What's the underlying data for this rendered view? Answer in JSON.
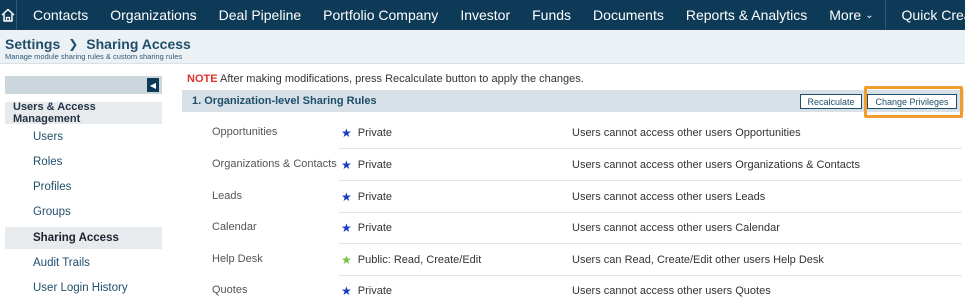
{
  "nav": {
    "home_icon": "home-icon",
    "items": [
      "Contacts",
      "Organizations",
      "Deal Pipeline",
      "Portfolio Company",
      "Investor",
      "Funds",
      "Documents",
      "Reports & Analytics"
    ],
    "more": "More",
    "quick_create": "Quick Create"
  },
  "breadcrumb": {
    "root": "Settings",
    "current": "Sharing Access",
    "subtitle": "Manage module sharing rules & custom sharing rules"
  },
  "sidebar": {
    "section": "Users & Access Management",
    "items": [
      "Users",
      "Roles",
      "Profiles",
      "Groups",
      "Sharing Access",
      "Audit Trails",
      "User Login History"
    ],
    "active_index": 4
  },
  "note": {
    "prefix": "NOTE",
    "text": "After making modifications, press Recalculate button to apply the changes."
  },
  "section": {
    "title": "1. Organization-level Sharing Rules",
    "recalculate": "Recalculate",
    "change_privileges": "Change Privileges"
  },
  "rules": [
    {
      "module": "Opportunities",
      "access": "Private",
      "star": "#1a3cc4",
      "desc": "Users cannot access other users Opportunities"
    },
    {
      "module": "Organizations & Contacts",
      "access": "Private",
      "star": "#1a3cc4",
      "desc": "Users cannot access other users Organizations & Contacts"
    },
    {
      "module": "Leads",
      "access": "Private",
      "star": "#1a3cc4",
      "desc": "Users cannot access other users Leads"
    },
    {
      "module": "Calendar",
      "access": "Private",
      "star": "#1a3cc4",
      "desc": "Users cannot access other users Calendar"
    },
    {
      "module": "Help Desk",
      "access": "Public: Read, Create/Edit",
      "star": "#7ac143",
      "desc": "Users can Read, Create/Edit other users Help Desk"
    },
    {
      "module": "Quotes",
      "access": "Private",
      "star": "#1a3cc4",
      "desc": "Users cannot access other users Quotes"
    }
  ],
  "colors": {
    "nav_bg": "#0d3a57",
    "highlight": "#f29c2b",
    "note_red": "#d9342b"
  }
}
